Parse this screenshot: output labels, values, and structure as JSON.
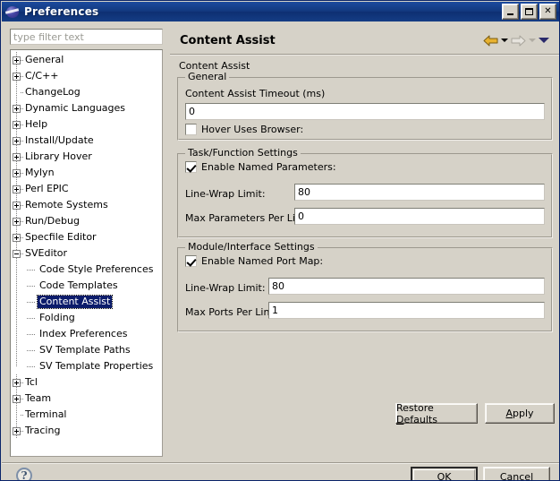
{
  "window": {
    "title": "Preferences",
    "icon": "eclipse-icon",
    "controls": {
      "minimize": "minimize-icon",
      "maximize": "maximize-icon",
      "close": "close-icon"
    }
  },
  "sidebar": {
    "filter": {
      "placeholder": "type filter text",
      "value": ""
    },
    "items": [
      {
        "label": "General",
        "depth": 0,
        "expander": "plus",
        "last": false
      },
      {
        "label": "C/C++",
        "depth": 0,
        "expander": "plus",
        "last": false
      },
      {
        "label": "ChangeLog",
        "depth": 0,
        "expander": "none",
        "last": false
      },
      {
        "label": "Dynamic Languages",
        "depth": 0,
        "expander": "plus",
        "last": false
      },
      {
        "label": "Help",
        "depth": 0,
        "expander": "plus",
        "last": false
      },
      {
        "label": "Install/Update",
        "depth": 0,
        "expander": "plus",
        "last": false
      },
      {
        "label": "Library Hover",
        "depth": 0,
        "expander": "plus",
        "last": false
      },
      {
        "label": "Mylyn",
        "depth": 0,
        "expander": "plus",
        "last": false
      },
      {
        "label": "Perl EPIC",
        "depth": 0,
        "expander": "plus",
        "last": false
      },
      {
        "label": "Remote Systems",
        "depth": 0,
        "expander": "plus",
        "last": false
      },
      {
        "label": "Run/Debug",
        "depth": 0,
        "expander": "plus",
        "last": false
      },
      {
        "label": "Specfile Editor",
        "depth": 0,
        "expander": "plus",
        "last": false
      },
      {
        "label": "SVEditor",
        "depth": 0,
        "expander": "minus",
        "last": false
      },
      {
        "label": "Code Style Preferences",
        "depth": 1,
        "expander": "none",
        "last": false
      },
      {
        "label": "Code Templates",
        "depth": 1,
        "expander": "none",
        "last": false
      },
      {
        "label": "Content Assist",
        "depth": 1,
        "expander": "none",
        "last": false,
        "selected": true
      },
      {
        "label": "Folding",
        "depth": 1,
        "expander": "none",
        "last": false
      },
      {
        "label": "Index Preferences",
        "depth": 1,
        "expander": "none",
        "last": false
      },
      {
        "label": "SV Template Paths",
        "depth": 1,
        "expander": "none",
        "last": false
      },
      {
        "label": "SV Template Properties",
        "depth": 1,
        "expander": "none",
        "last": true
      },
      {
        "label": "Tcl",
        "depth": 0,
        "expander": "plus",
        "last": false
      },
      {
        "label": "Team",
        "depth": 0,
        "expander": "plus",
        "last": false
      },
      {
        "label": "Terminal",
        "depth": 0,
        "expander": "none",
        "last": false
      },
      {
        "label": "Tracing",
        "depth": 0,
        "expander": "plus",
        "last": true
      }
    ]
  },
  "main": {
    "title": "Content Assist",
    "subtitle": "Content Assist",
    "nav": {
      "back": "back-arrow-icon",
      "back_menu": "back-dropdown-icon",
      "forward": "forward-arrow-icon",
      "forward_menu": "forward-dropdown-icon",
      "menu": "view-menu-icon"
    },
    "groups": {
      "general": {
        "title": "General",
        "timeout_label": "Content Assist Timeout (ms)",
        "timeout_value": "0",
        "hover_label": "Hover Uses Browser:",
        "hover_checked": false
      },
      "task_function": {
        "title": "Task/Function Settings",
        "enable_label": "Enable Named Parameters:",
        "enable_checked": true,
        "linewrap_label": "Line-Wrap Limit:",
        "linewrap_value": "80",
        "maxparams_label": "Max Parameters Per Line:",
        "maxparams_value": "0"
      },
      "module_interface": {
        "title": "Module/Interface Settings",
        "enable_label": "Enable Named Port Map:",
        "enable_checked": true,
        "linewrap_label": "Line-Wrap Limit:",
        "linewrap_value": "80",
        "maxports_label": "Max Ports Per Line:",
        "maxports_value": "1"
      }
    },
    "buttons": {
      "restore_defaults_pre": "Restore ",
      "restore_defaults_key": "D",
      "restore_defaults_post": "efaults",
      "apply_key": "A",
      "apply_post": "pply"
    }
  },
  "footer": {
    "help": "?",
    "ok": "OK",
    "cancel": "Cancel"
  },
  "colors": {
    "title_bar": "#12387f",
    "dialog_bg": "#d6d2c8",
    "selection": "#0c1c6b",
    "back_arrow": "#e8b230",
    "forward_arrow": "#cfcbc2",
    "menu_chevron": "#29296b"
  }
}
